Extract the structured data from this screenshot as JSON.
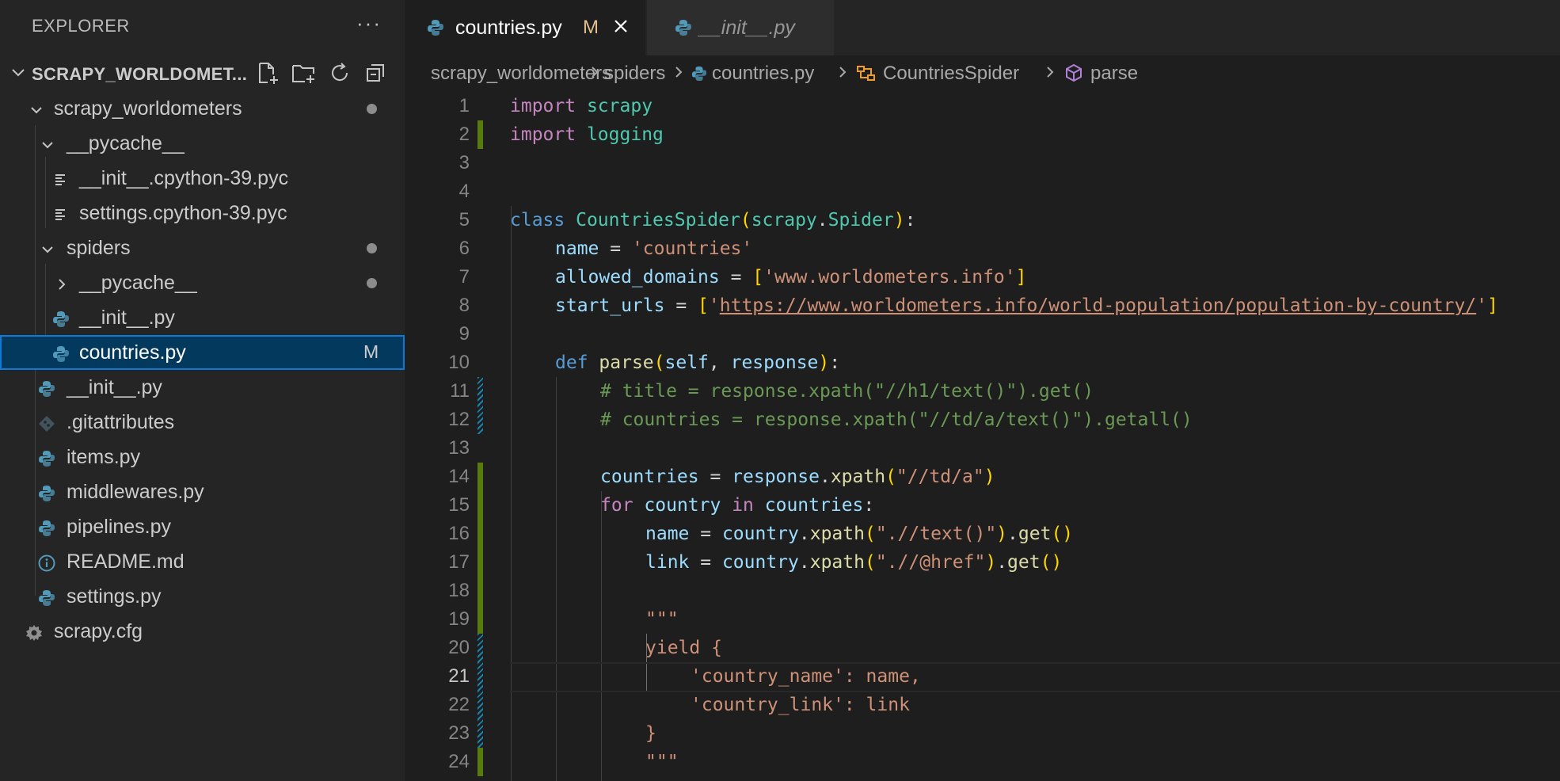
{
  "sidebar": {
    "header": "EXPLORER",
    "more": "···",
    "root": "SCRAPY_WORLDOMET...",
    "tree": [
      {
        "label": "scrapy_worldometers"
      },
      {
        "label": "__pycache__"
      },
      {
        "label": "__init__.cpython-39.pyc"
      },
      {
        "label": "settings.cpython-39.pyc"
      },
      {
        "label": "spiders"
      },
      {
        "label": "__pycache__"
      },
      {
        "label": "__init__.py"
      },
      {
        "label": "countries.py",
        "badge": "M"
      },
      {
        "label": "__init__.py"
      },
      {
        "label": ".gitattributes"
      },
      {
        "label": "items.py"
      },
      {
        "label": "middlewares.py"
      },
      {
        "label": "pipelines.py"
      },
      {
        "label": "README.md"
      },
      {
        "label": "settings.py"
      },
      {
        "label": "scrapy.cfg"
      }
    ]
  },
  "tabs": [
    {
      "label": "countries.py",
      "badge": "M"
    },
    {
      "label": "__init__.py"
    }
  ],
  "breadcrumb": [
    "scrapy_worldometers",
    "spiders",
    "countries.py",
    "CountriesSpider",
    "parse"
  ],
  "line_numbers": [
    "1",
    "2",
    "3",
    "4",
    "5",
    "6",
    "7",
    "8",
    "9",
    "10",
    "11",
    "12",
    "13",
    "14",
    "15",
    "16",
    "17",
    "18",
    "19",
    "20",
    "21",
    "22",
    "23",
    "24"
  ],
  "code": {
    "l1": [
      "import",
      "scrapy"
    ],
    "l2": [
      "import",
      "logging"
    ],
    "l5": [
      "class",
      "CountriesSpider",
      "(",
      "scrapy",
      ".",
      "Spider",
      ")",
      ":"
    ],
    "l6": [
      "name",
      " = ",
      "'countries'"
    ],
    "l7": [
      "allowed_domains",
      " = ",
      "[",
      "'www.worldometers.info'",
      "]"
    ],
    "l8": [
      "start_urls",
      " = ",
      "[",
      "'",
      "https://www.worldometers.info/world-population/population-by-country/",
      "'",
      "]"
    ],
    "l10": [
      "def",
      "parse",
      "(",
      "self",
      ", ",
      "response",
      ")",
      ":"
    ],
    "l11": "# title = response.xpath(\"//h1/text()\").get()",
    "l12": "# countries = response.xpath(\"//td/a/text()\").getall()",
    "l14": [
      "countries",
      " = ",
      "response",
      ".",
      "xpath",
      "(",
      "\"//td/a\"",
      ")"
    ],
    "l15": [
      "for",
      "country",
      "in",
      "countries",
      ":"
    ],
    "l16": [
      "name",
      " = ",
      "country",
      ".",
      "xpath",
      "(",
      "\".//text()\"",
      ")",
      ".",
      "get",
      "(",
      ")"
    ],
    "l17": [
      "link",
      " = ",
      "country",
      ".",
      "xpath",
      "(",
      "\".//@href\"",
      ")",
      ".",
      "get",
      "(",
      ")"
    ],
    "l19": "\"\"\"",
    "l20": "yield {",
    "l21": "'country_name': name,",
    "l22": "'country_link': link",
    "l23": "}",
    "l24": "\"\"\""
  }
}
